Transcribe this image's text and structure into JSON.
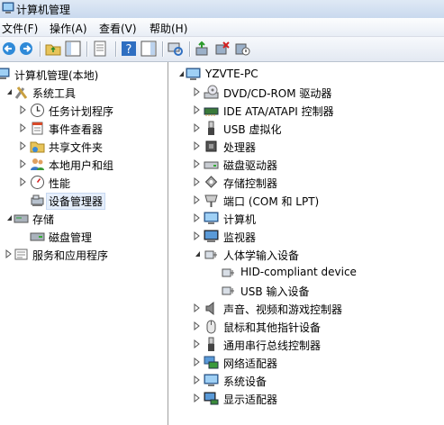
{
  "window": {
    "title": "计算机管理"
  },
  "menu": [
    "文件(F)",
    "操作(A)",
    "查看(V)",
    "帮助(H)"
  ],
  "toolbar": {
    "buttons": [
      "back-icon",
      "forward-icon",
      "up-folder-icon",
      "show-hide-tree-icon",
      "export-list-icon",
      "help-icon",
      "action-pane-icon",
      "scan-hardware-icon",
      "update-driver-icon",
      "uninstall-icon",
      "disable-icon"
    ]
  },
  "left_tree": {
    "root": "计算机管理(本地)",
    "system_tools": "系统工具",
    "task_scheduler": "任务计划程序",
    "event_viewer": "事件查看器",
    "shared_folders": "共享文件夹",
    "local_users": "本地用户和组",
    "performance": "性能",
    "device_manager": "设备管理器",
    "storage": "存储",
    "disk_management": "磁盘管理",
    "services_apps": "服务和应用程序"
  },
  "device_tree": {
    "computer_name": "YZVTE-PC",
    "categories": [
      "DVD/CD-ROM 驱动器",
      "IDE ATA/ATAPI 控制器",
      "USB 虚拟化",
      "处理器",
      "磁盘驱动器",
      "存储控制器",
      "端口 (COM 和 LPT)",
      "计算机",
      "监视器",
      "人体学输入设备",
      "HID-compliant device",
      "USB 输入设备",
      "声音、视频和游戏控制器",
      "鼠标和其他指针设备",
      "通用串行总线控制器",
      "网络适配器",
      "系统设备",
      "显示适配器"
    ]
  },
  "colors": {
    "titlebar": "#c9d9ee",
    "selection": "#e5eefb",
    "icon_blue": "#2f6fc1",
    "icon_green": "#3a9a3a"
  }
}
